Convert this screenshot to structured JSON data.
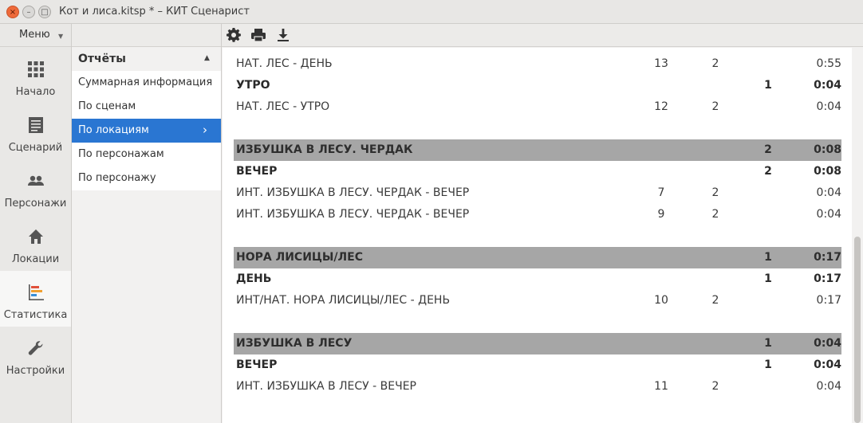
{
  "window": {
    "title": "Кот и лиса.kitsp * – КИТ Сценарист",
    "close_glyph": "×",
    "minimize_glyph": "–",
    "maximize_glyph": "□"
  },
  "nav": {
    "menu_label": "Меню",
    "menu_arrow": "▼",
    "items": [
      {
        "label": "Начало",
        "icon": "grid-icon"
      },
      {
        "label": "Сценарий",
        "icon": "document-icon"
      },
      {
        "label": "Персонажи",
        "icon": "people-icon"
      },
      {
        "label": "Локации",
        "icon": "home-icon"
      },
      {
        "label": "Статистика",
        "icon": "chart-icon"
      },
      {
        "label": "Настройки",
        "icon": "wrench-icon"
      }
    ],
    "active": "Статистика"
  },
  "reports": {
    "header": "Отчёты",
    "collapse_glyph": "▲",
    "items": [
      {
        "label": "Суммарная информация"
      },
      {
        "label": "По сценам"
      },
      {
        "label": "По локациям"
      },
      {
        "label": "По персонажам"
      },
      {
        "label": "По персонажу"
      }
    ],
    "active": "По локациям",
    "active_chevron": "›"
  },
  "toolbar": {
    "icons": [
      "gear-icon",
      "print-icon",
      "download-icon"
    ]
  },
  "colors": {
    "accent": "#2a76d2",
    "location_row_bg": "#a6a6a6"
  },
  "report_rows": [
    {
      "type": "scene",
      "name": "НАТ. ЛЕС - ДЕНЬ",
      "num": "13",
      "chars": "2",
      "count": "",
      "time": "0:55"
    },
    {
      "type": "tod",
      "name": "УТРО",
      "num": "",
      "chars": "",
      "count": "1",
      "time": "0:04"
    },
    {
      "type": "scene",
      "name": "НАТ. ЛЕС - УТРО",
      "num": "12",
      "chars": "2",
      "count": "",
      "time": "0:04"
    },
    {
      "type": "loc",
      "name": "ИЗБУШКА В ЛЕСУ. ЧЕРДАК",
      "num": "",
      "chars": "",
      "count": "2",
      "time": "0:08"
    },
    {
      "type": "tod",
      "name": "ВЕЧЕР",
      "num": "",
      "chars": "",
      "count": "2",
      "time": "0:08"
    },
    {
      "type": "scene",
      "name": "ИНТ. ИЗБУШКА В ЛЕСУ. ЧЕРДАК - ВЕЧЕР",
      "num": "7",
      "chars": "2",
      "count": "",
      "time": "0:04"
    },
    {
      "type": "scene",
      "name": "ИНТ. ИЗБУШКА В ЛЕСУ. ЧЕРДАК - ВЕЧЕР",
      "num": "9",
      "chars": "2",
      "count": "",
      "time": "0:04"
    },
    {
      "type": "loc",
      "name": "НОРА ЛИСИЦЫ/ЛЕС",
      "num": "",
      "chars": "",
      "count": "1",
      "time": "0:17"
    },
    {
      "type": "tod",
      "name": "ДЕНЬ",
      "num": "",
      "chars": "",
      "count": "1",
      "time": "0:17"
    },
    {
      "type": "scene",
      "name": "ИНТ/НАТ. НОРА ЛИСИЦЫ/ЛЕС - ДЕНЬ",
      "num": "10",
      "chars": "2",
      "count": "",
      "time": "0:17"
    },
    {
      "type": "loc",
      "name": "ИЗБУШКА В ЛЕСУ",
      "num": "",
      "chars": "",
      "count": "1",
      "time": "0:04"
    },
    {
      "type": "tod",
      "name": "ВЕЧЕР",
      "num": "",
      "chars": "",
      "count": "1",
      "time": "0:04"
    },
    {
      "type": "scene",
      "name": "ИНТ. ИЗБУШКА В ЛЕСУ - ВЕЧЕР",
      "num": "11",
      "chars": "2",
      "count": "",
      "time": "0:04"
    }
  ]
}
